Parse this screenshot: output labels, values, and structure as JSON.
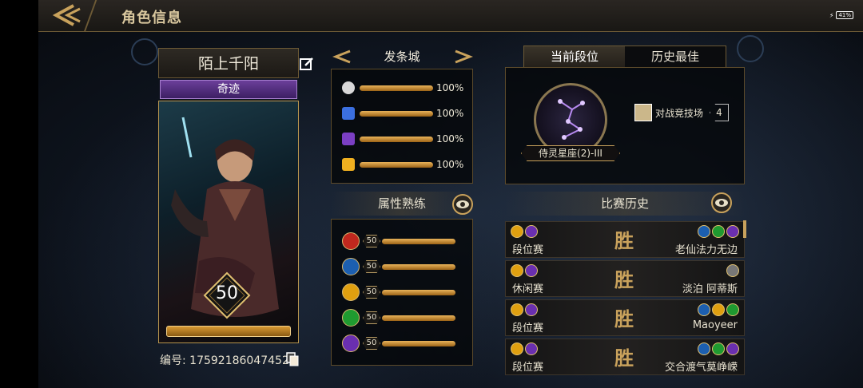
{
  "header": {
    "title": "角色信息",
    "battery": "41%"
  },
  "profile": {
    "name": "陌上千阳",
    "rank_title": "奇迹",
    "level": "50",
    "id_label": "编号: 17592186047452"
  },
  "city": {
    "name": "发条城",
    "resources": [
      {
        "icon": "silver-orb-icon",
        "value": "100%",
        "fill": 1.0,
        "color": "#d8d8d8"
      },
      {
        "icon": "blue-triangle-icon",
        "value": "100%",
        "fill": 1.0,
        "color": "#3b6fe0"
      },
      {
        "icon": "purple-gem-icon",
        "value": "100%",
        "fill": 1.0,
        "color": "#7b3fc4"
      },
      {
        "icon": "gold-hex-icon",
        "value": "100%",
        "fill": 1.0,
        "color": "#f0b020"
      }
    ]
  },
  "proficiency": {
    "title": "属性熟练",
    "rows": [
      {
        "icon": "fire-icon",
        "value": "50",
        "color": "#c0281e"
      },
      {
        "icon": "book-icon",
        "value": "50",
        "color": "#1c5fb0"
      },
      {
        "icon": "wind-icon",
        "value": "50",
        "color": "#e0a010"
      },
      {
        "icon": "leaf-icon",
        "value": "50",
        "color": "#1f9a30"
      },
      {
        "icon": "anvil-icon",
        "value": "50",
        "color": "#6a2fb0"
      }
    ]
  },
  "rank_tabs": {
    "current": "当前段位",
    "best": "历史最佳"
  },
  "rank": {
    "label": "侍灵星座(2)-III",
    "arena_label": "对战竞技场",
    "arena_value": "4"
  },
  "history": {
    "title": "比赛历史",
    "matches": [
      {
        "type": "段位赛",
        "result": "胜",
        "opponent": "老仙法力无边"
      },
      {
        "type": "休闲赛",
        "result": "胜",
        "opponent": "淡泊 阿蒂斯"
      },
      {
        "type": "段位赛",
        "result": "胜",
        "opponent": "Maoyeer"
      },
      {
        "type": "段位赛",
        "result": "胜",
        "opponent": "交合渡气莫峥嵘"
      }
    ]
  }
}
